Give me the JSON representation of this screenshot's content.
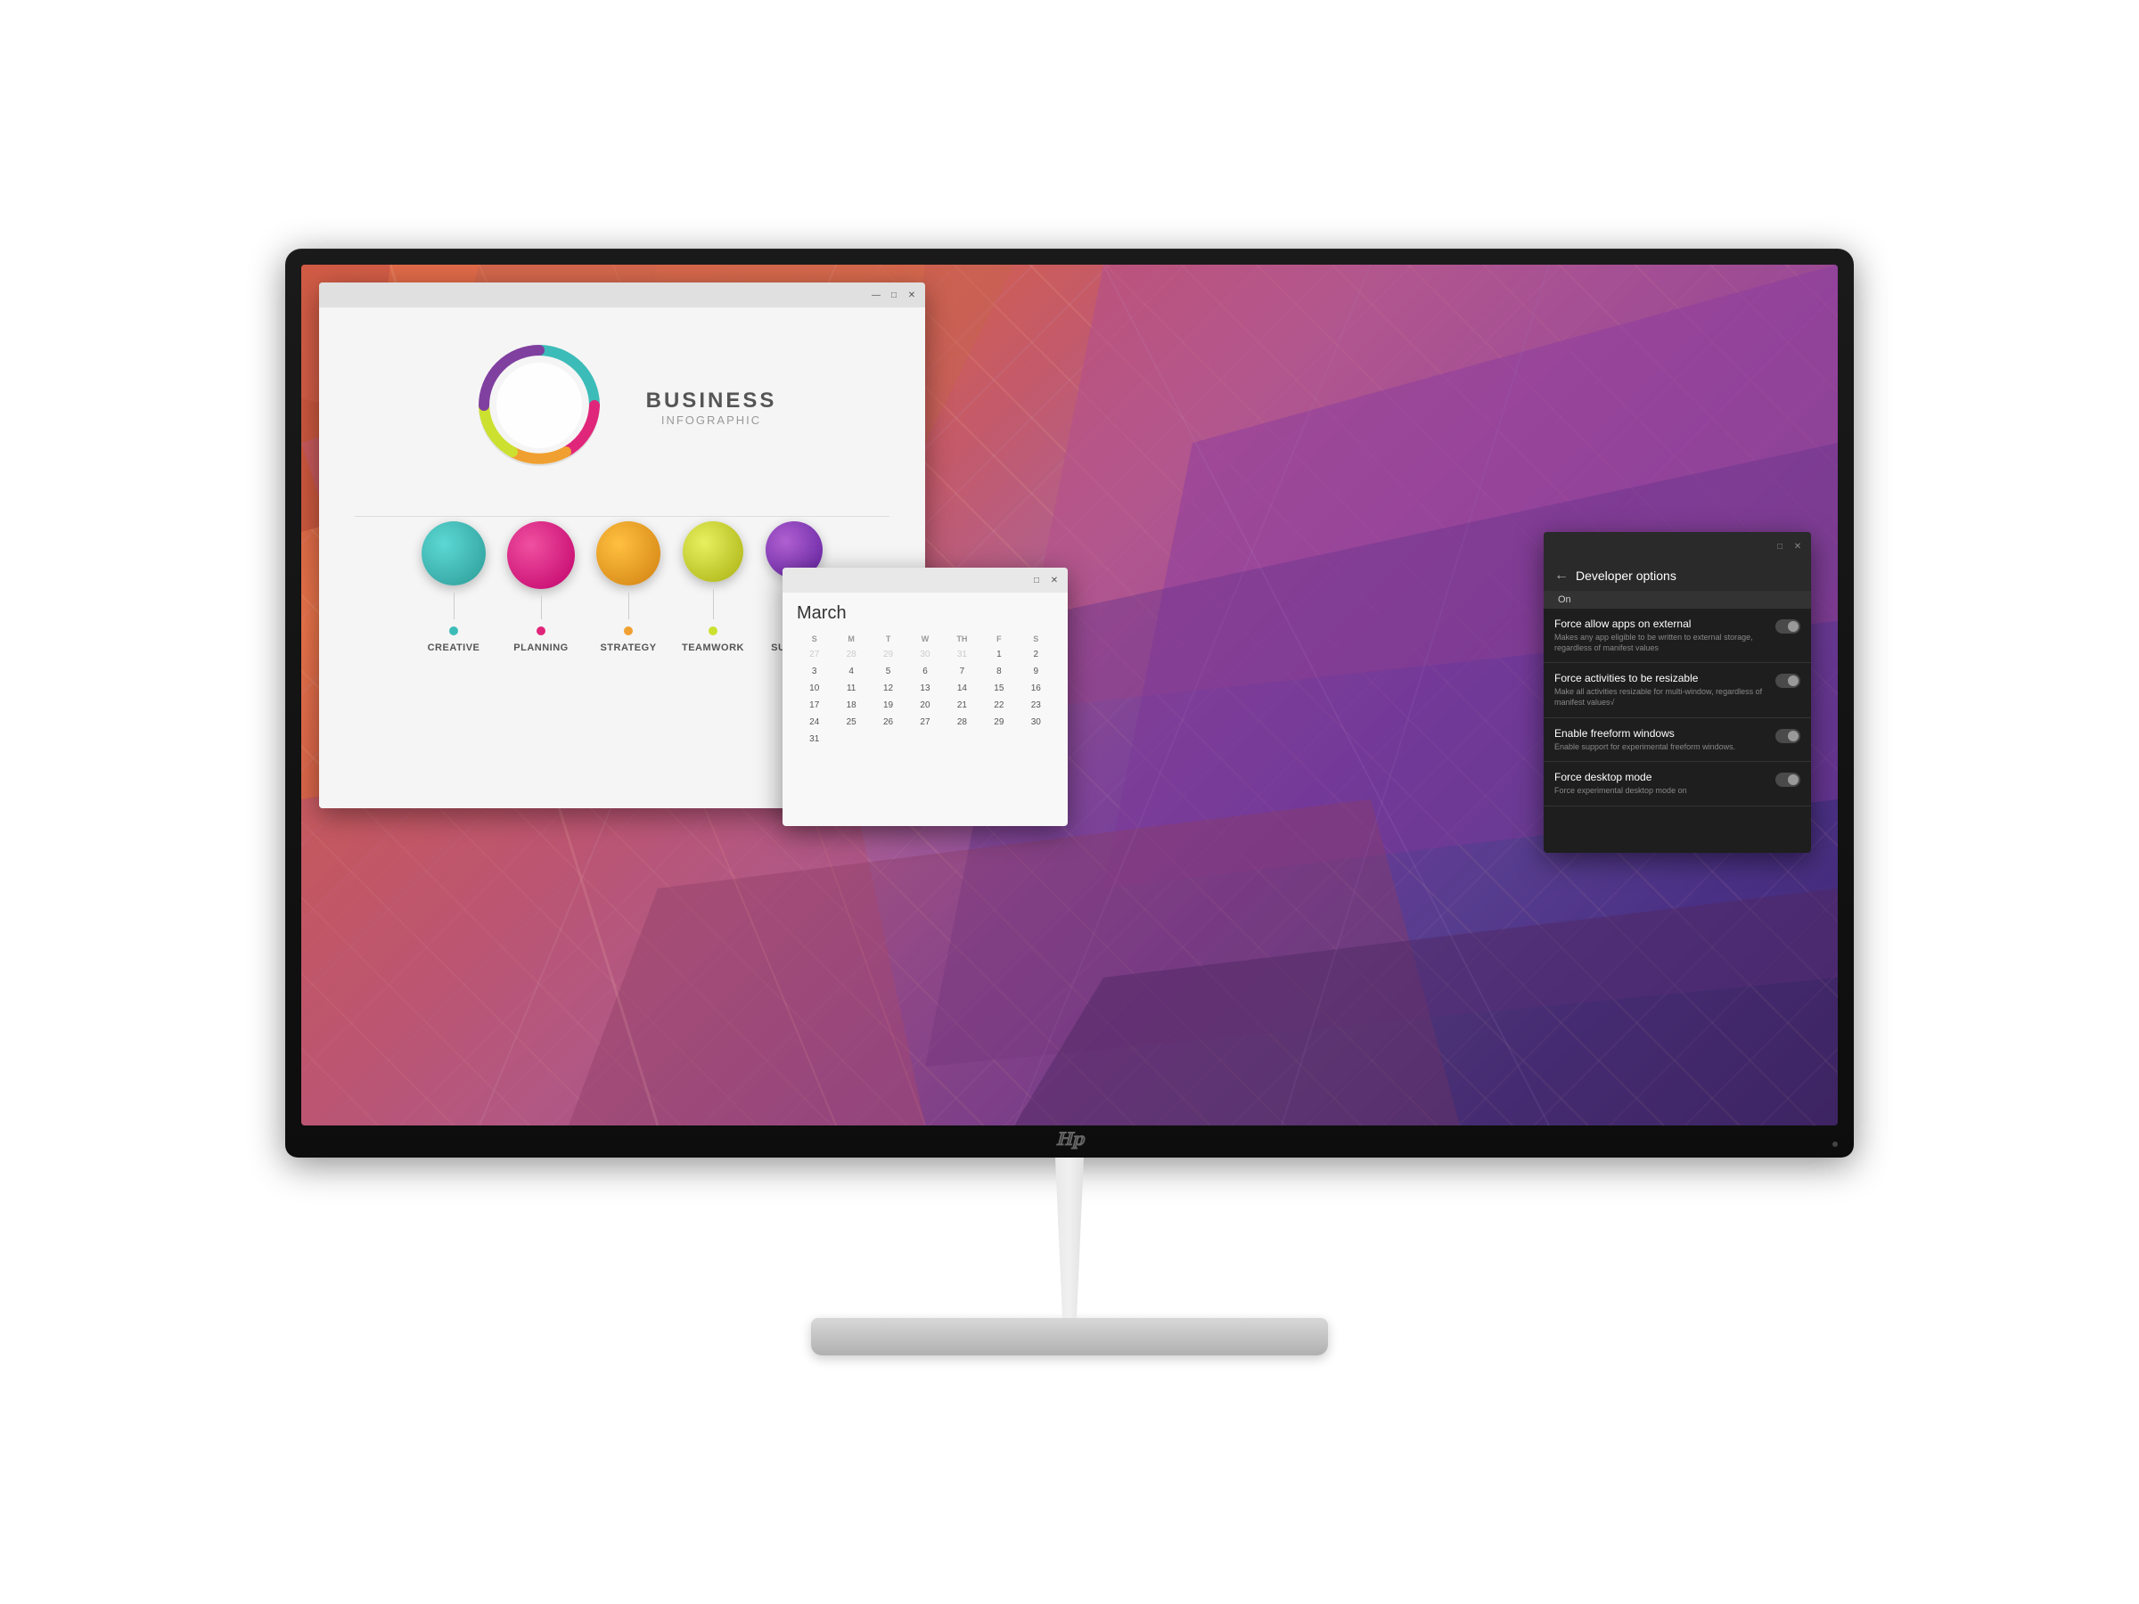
{
  "monitor": {
    "brand": "hp",
    "brand_symbol": "ℍ𝕡"
  },
  "infographic_window": {
    "title": "Business Infographic",
    "title_line1": "BUSINESS",
    "title_line2": "INFOGRAPHIC",
    "window_buttons": [
      "—",
      "□",
      "✕"
    ],
    "labels": [
      "CREATIVE",
      "PLANNING",
      "STRATEGY",
      "TEAMWORK",
      "SUCCE..."
    ],
    "bubble_colors": [
      "#3cbcb8",
      "#e0267a",
      "#f0a030",
      "#cce030",
      "#8040a0"
    ],
    "bubble_sizes": [
      72,
      76,
      72,
      68,
      64
    ]
  },
  "calendar_window": {
    "month": "March",
    "window_buttons": [
      "□",
      "✕"
    ],
    "day_headers": [
      "S",
      "M",
      "T",
      "W",
      "TH",
      "F",
      "S"
    ],
    "weeks": [
      [
        "27",
        "28",
        "29",
        "30",
        "31",
        "1",
        "2"
      ],
      [
        "3",
        "4",
        "5",
        "6",
        "7",
        "8",
        "9"
      ],
      [
        "10",
        "11",
        "12",
        "13",
        "14",
        "15",
        "16"
      ],
      [
        "17",
        "18",
        "19",
        "20",
        "21",
        "22",
        "23"
      ],
      [
        "24",
        "25",
        "26",
        "27",
        "28",
        "29",
        "30"
      ],
      [
        "31",
        "",
        "",
        "",
        "",
        "",
        ""
      ]
    ],
    "other_month_cols_first_row": [
      0,
      1,
      2,
      3,
      4
    ]
  },
  "dev_window": {
    "title": "Developer options",
    "back_arrow": "←",
    "window_buttons": [
      "□",
      "✕"
    ],
    "on_label": "On",
    "options": [
      {
        "title": "Force allow apps on external",
        "desc": "Makes any app eligible to be written to external storage, regardless of manifest values"
      },
      {
        "title": "Force activities to be resizable",
        "desc": "Make all activities resizable for multi-window, regardless of manifest values√"
      },
      {
        "title": "Enable freeform windows",
        "desc": "Enable support for experimental freeform windows."
      },
      {
        "title": "Force desktop mode",
        "desc": "Force experimental desktop mode on"
      }
    ]
  }
}
